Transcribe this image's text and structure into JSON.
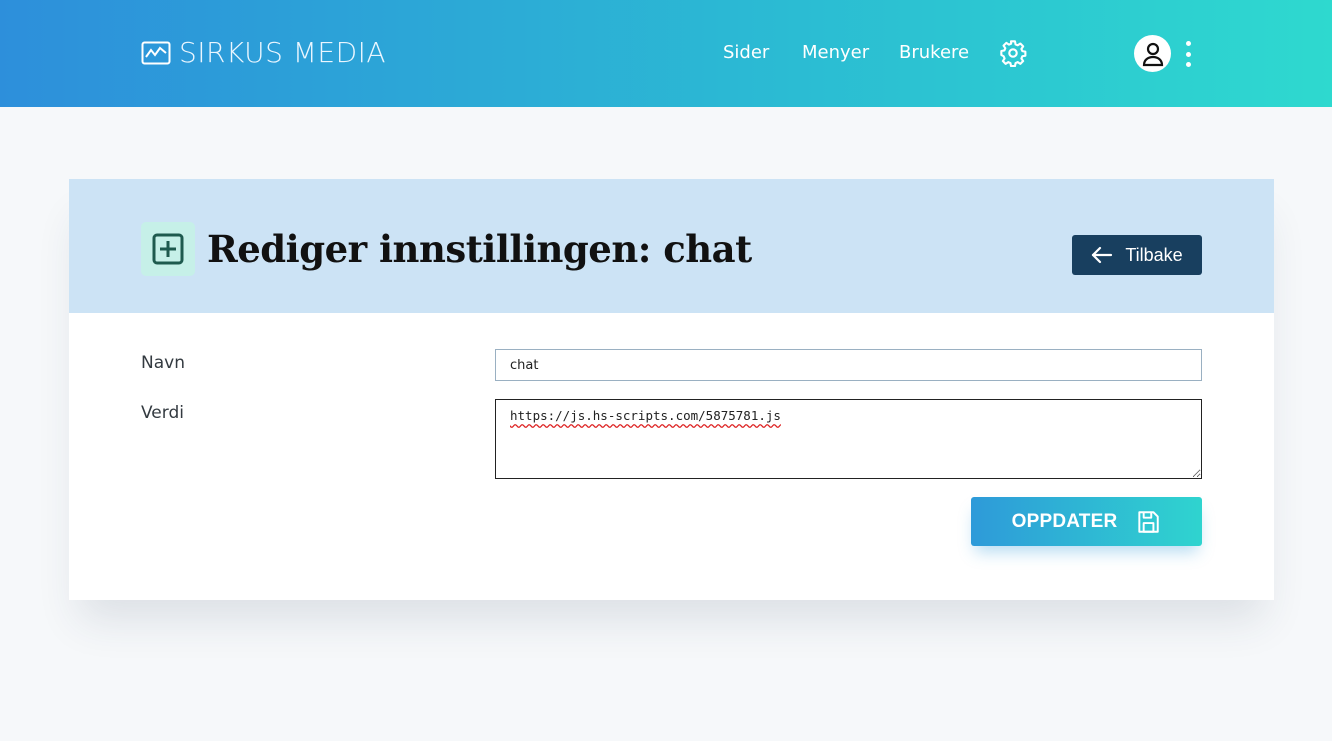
{
  "header": {
    "brand": "SIRKUS MEDIA",
    "brand_icon": "activity-chart-icon",
    "nav": [
      "Sider",
      "Menyer",
      "Brukere"
    ],
    "settings_icon": "gear-icon",
    "user_icon": "user-avatar-icon",
    "more_icon": "kebab-menu-icon"
  },
  "page": {
    "title": "Rediger innstillingen: chat",
    "title_icon": "plus-square-icon",
    "back_label": "Tilbake",
    "back_icon": "arrow-left-icon"
  },
  "form": {
    "name_label": "Navn",
    "name_value": "chat",
    "value_label": "Verdi",
    "value_value": "https://js.hs-scripts.com/5875781.js",
    "submit_label": "OPPDATER",
    "submit_icon": "save-icon"
  },
  "colors": {
    "header_gradient_start": "#2d8fdb",
    "header_gradient_end": "#2ed9cf",
    "card_header_bg": "#cce3f5",
    "back_button_bg": "#183f5f",
    "icon_badge_bg": "#c6f0e8"
  }
}
